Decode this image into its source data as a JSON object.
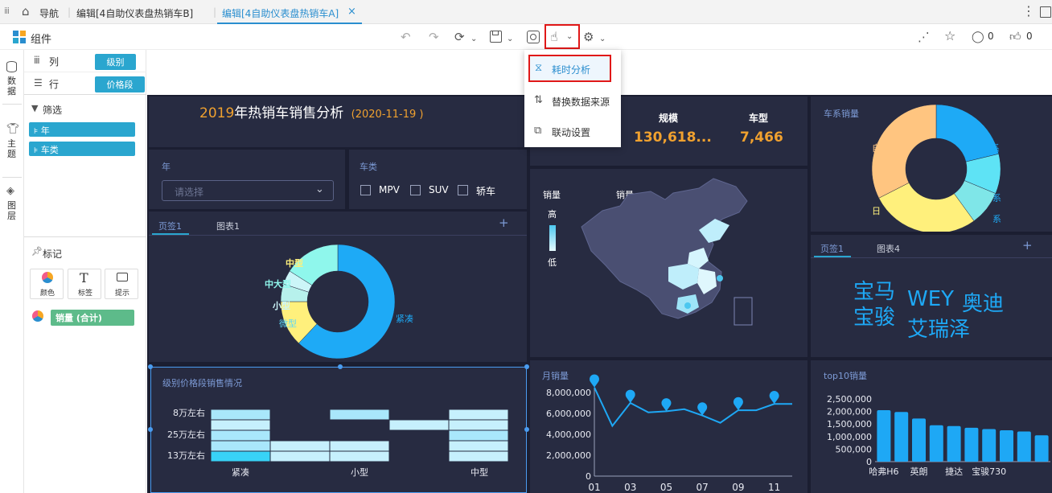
{
  "tabs": {
    "nav": "导航",
    "tab1": "编辑[4自助仪表盘热销车B]",
    "tab2": "编辑[4自助仪表盘热销车A]",
    "close": "×"
  },
  "toolbar": {
    "components": "组件"
  },
  "social": {
    "comments": "0",
    "likes": "0"
  },
  "sidebar": {
    "data": "数据",
    "theme": "主题",
    "layers": "图层"
  },
  "fields": {
    "col_label": "列",
    "row_label": "行",
    "col_pill": "级别",
    "row_pill": "价格段",
    "filter_title": "筛选",
    "filters": [
      "年",
      "车类"
    ],
    "mark_title": "标记",
    "mark_buttons": [
      "颜色",
      "标签",
      "提示"
    ],
    "measure": "销量 (合计)"
  },
  "menu": {
    "items": [
      "耗时分析",
      "替换数据来源",
      "联动设置"
    ]
  },
  "dashboard": {
    "title_year": "2019",
    "title_rest": "年热销车销售分析",
    "title_date": "(2020-11-19 )",
    "kpi": {
      "label1": "规模",
      "value1": "130,618...",
      "label2": "车型",
      "value2": "7,466"
    },
    "filter_year": {
      "title": "年",
      "placeholder": "请选择"
    },
    "filter_type": {
      "title": "车类",
      "options": [
        "MPV",
        "SUV",
        "轿车"
      ]
    },
    "tabs_left": [
      "页签1",
      "图表1"
    ],
    "tabs_right": [
      "页签1",
      "图表4"
    ],
    "plus": "+",
    "map": {
      "legend1": "销量",
      "legend2": "销量",
      "high": "高",
      "low": "低"
    },
    "series_title": "车系销量",
    "wordcloud": [
      "宝马",
      "宝骏",
      "WEY",
      "奥迪",
      "艾瑞泽"
    ],
    "heat_title": "级别价格段销售情况",
    "month_title": "月销量",
    "top10_title": "top10销量"
  },
  "colors": {
    "accent": "#2aa6cf",
    "dash_bg": "#1b1e31",
    "card_bg": "#272b41",
    "title_orange": "#f0a12f",
    "bar_blue": "#1ea8f5"
  },
  "chart_data": [
    {
      "type": "pie",
      "title": "",
      "categories": [
        "紧凑",
        "中型",
        "中大型",
        "小型",
        "微型"
      ],
      "values": [
        62,
        13,
        5,
        4,
        16
      ],
      "colors": [
        "#1eaaf6",
        "#fff07c",
        "#b7f1ec",
        "#ccf5f8",
        "#8ff7ec"
      ]
    },
    {
      "type": "pie",
      "title": "车系销量",
      "categories": [
        "自",
        "系",
        "系2",
        "系3",
        "日"
      ],
      "values": [
        26,
        17,
        8,
        7,
        22
      ],
      "colors": [
        "#ffc580",
        "#1eaaf6",
        "#5ee3f5",
        "#7fe6e8",
        "#fff07c"
      ],
      "labels": [
        "自",
        "系",
        "系",
        "系",
        "日"
      ]
    },
    {
      "type": "line",
      "title": "月销量",
      "x": [
        "01",
        "02",
        "03",
        "04",
        "05",
        "06",
        "07",
        "08",
        "09",
        "10",
        "11",
        "12"
      ],
      "x_ticks": [
        "01",
        "03",
        "05",
        "07",
        "09",
        "11"
      ],
      "values": [
        8500000,
        4800000,
        7000000,
        6100000,
        6200000,
        6400000,
        5800000,
        5100000,
        6300000,
        6300000,
        6900000,
        6900000
      ],
      "ylim": [
        0,
        8000000
      ],
      "y_ticks": [
        "0",
        "2,000,000",
        "4,000,000",
        "6,000,000",
        "8,000,000"
      ],
      "y_tick_values": [
        0,
        2000000,
        4000000,
        6000000,
        8000000
      ],
      "markers_at": [
        0,
        2,
        4,
        6,
        8,
        10
      ]
    },
    {
      "type": "bar",
      "title": "top10销量",
      "categories": [
        "哈弗H6",
        "",
        "英朗",
        "",
        "捷达",
        "",
        "宝骏730",
        "",
        "",
        ""
      ],
      "x_ticks": [
        "哈弗H6",
        "英朗",
        "捷达",
        "宝骏730"
      ],
      "values": [
        2050000,
        1980000,
        1720000,
        1450000,
        1420000,
        1350000,
        1300000,
        1250000,
        1200000,
        1050000
      ],
      "ylim": [
        0,
        2500000
      ],
      "y_ticks": [
        "0",
        "500,000",
        "1,000,000",
        "1,500,000",
        "2,000,000",
        "2,500,000"
      ],
      "y_tick_values": [
        0,
        500000,
        1000000,
        1500000,
        2000000,
        2500000
      ]
    },
    {
      "type": "heatmap",
      "title": "级别价格段销售情况",
      "x_ticks": [
        "紧凑",
        "小型",
        "中型"
      ],
      "y_ticks": [
        "8万左右",
        "25万左右",
        "13万左右"
      ]
    }
  ]
}
